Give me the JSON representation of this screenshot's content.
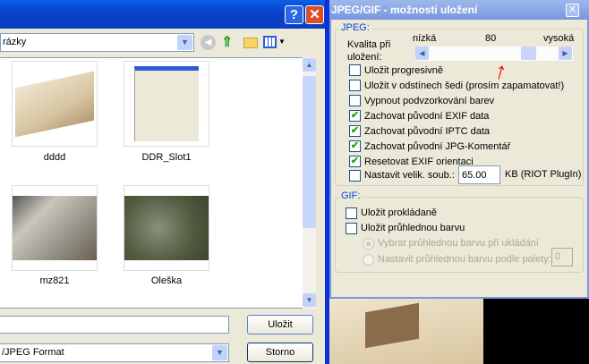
{
  "save_dialog": {
    "folder": "rázky",
    "files": [
      {
        "name": "dddd"
      },
      {
        "name": "DDR_Slot1"
      },
      {
        "name": "mz821"
      },
      {
        "name": "Oleška"
      }
    ],
    "filename_value": "",
    "filetype": "/JPEG Format",
    "save_label": "Uložit",
    "cancel_label": "Storno",
    "help_label": "?",
    "close_label": "✕"
  },
  "options_dialog": {
    "title": "JPEG/GIF - možnosti uložení",
    "close_label": "✕",
    "jpeg_group": "JPEG:",
    "quality_label": "Kvalita při uložení:",
    "low": "nízká",
    "high": "vysoká",
    "quality": "80",
    "quality_fraction": 0.8,
    "checkboxes": [
      {
        "label": "Uložit progresivně",
        "checked": false
      },
      {
        "label": "Uložit v odstínech šedi (prosím zapamatovat!)",
        "checked": false
      },
      {
        "label": "Vypnout podvzorkování barev",
        "checked": false
      },
      {
        "label": "Zachovat původní EXIF data",
        "checked": true
      },
      {
        "label": "Zachovat původní IPTC data",
        "checked": true
      },
      {
        "label": "Zachovat původní JPG-Komentář",
        "checked": true
      },
      {
        "label": "Resetovat EXIF orientaci",
        "checked": true
      }
    ],
    "filesize_label": "Nastavit velik. soub.:",
    "filesize_value": "65.00",
    "filesize_unit": "KB (RIOT PlugIn)",
    "gif_group": "GIF:",
    "gif_interlaced": "Uložit prokládaně",
    "gif_transparent": "Uložit průhlednou barvu",
    "radio_pick": "Vybrat průhlednou barvu při ukládání",
    "radio_palette": "Nastavit průhlednou barvu podle palety:",
    "palette_index": "0"
  }
}
